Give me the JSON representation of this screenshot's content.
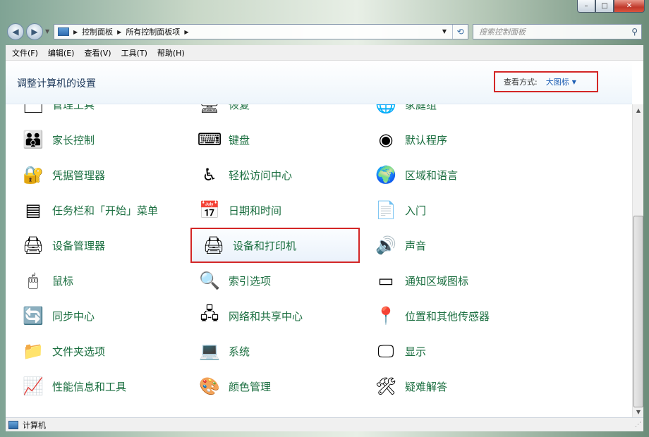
{
  "window": {
    "caption": {
      "minimize": "–",
      "maximize": "□",
      "close": "✕"
    }
  },
  "nav": {
    "back": "◀",
    "forward": "▶",
    "breadcrumbs": [
      "控制面板",
      "所有控制面板项"
    ],
    "search_placeholder": "搜索控制面板"
  },
  "menu": [
    "文件(F)",
    "编辑(E)",
    "查看(V)",
    "工具(T)",
    "帮助(H)"
  ],
  "header": {
    "title": "调整计算机的设置",
    "viewby_label": "查看方式:",
    "viewby_value": "大图标"
  },
  "items": [
    {
      "label": "管理工具",
      "icon": "admin-tools-icon",
      "glyph": "🗂"
    },
    {
      "label": "恢复",
      "icon": "recovery-icon",
      "glyph": "🖥"
    },
    {
      "label": "家庭组",
      "icon": "homegroup-icon",
      "glyph": "🌐"
    },
    {
      "label": "家长控制",
      "icon": "parental-controls-icon",
      "glyph": "👪"
    },
    {
      "label": "键盘",
      "icon": "keyboard-icon",
      "glyph": "⌨"
    },
    {
      "label": "默认程序",
      "icon": "default-programs-icon",
      "glyph": "◉"
    },
    {
      "label": "凭据管理器",
      "icon": "credential-manager-icon",
      "glyph": "🔐"
    },
    {
      "label": "轻松访问中心",
      "icon": "ease-of-access-icon",
      "glyph": "♿"
    },
    {
      "label": "区域和语言",
      "icon": "region-language-icon",
      "glyph": "🌍"
    },
    {
      "label": "任务栏和「开始」菜单",
      "icon": "taskbar-start-menu-icon",
      "glyph": "▤"
    },
    {
      "label": "日期和时间",
      "icon": "date-time-icon",
      "glyph": "📅"
    },
    {
      "label": "入门",
      "icon": "getting-started-icon",
      "glyph": "📄"
    },
    {
      "label": "设备管理器",
      "icon": "device-manager-icon",
      "glyph": "🖨"
    },
    {
      "label": "设备和打印机",
      "icon": "devices-printers-icon",
      "glyph": "🖨"
    },
    {
      "label": "声音",
      "icon": "sound-icon",
      "glyph": "🔊"
    },
    {
      "label": "鼠标",
      "icon": "mouse-icon",
      "glyph": "🖱"
    },
    {
      "label": "索引选项",
      "icon": "indexing-options-icon",
      "glyph": "🔍"
    },
    {
      "label": "通知区域图标",
      "icon": "notification-area-icon",
      "glyph": "▭"
    },
    {
      "label": "同步中心",
      "icon": "sync-center-icon",
      "glyph": "🔄"
    },
    {
      "label": "网络和共享中心",
      "icon": "network-sharing-icon",
      "glyph": "🖧"
    },
    {
      "label": "位置和其他传感器",
      "icon": "location-sensors-icon",
      "glyph": "📍"
    },
    {
      "label": "文件夹选项",
      "icon": "folder-options-icon",
      "glyph": "📁"
    },
    {
      "label": "系统",
      "icon": "system-icon",
      "glyph": "💻"
    },
    {
      "label": "显示",
      "icon": "display-icon",
      "glyph": "🖵"
    },
    {
      "label": "性能信息和工具",
      "icon": "performance-icon",
      "glyph": "📈"
    },
    {
      "label": "颜色管理",
      "icon": "color-management-icon",
      "glyph": "🎨"
    },
    {
      "label": "疑难解答",
      "icon": "troubleshooting-icon",
      "glyph": "🛠"
    }
  ],
  "highlighted_item": "设备和打印机",
  "status": {
    "text": "计算机"
  },
  "colors": {
    "link_green": "#1a6e3f",
    "highlight_red": "#d32626",
    "title_blue": "#1e395b"
  }
}
